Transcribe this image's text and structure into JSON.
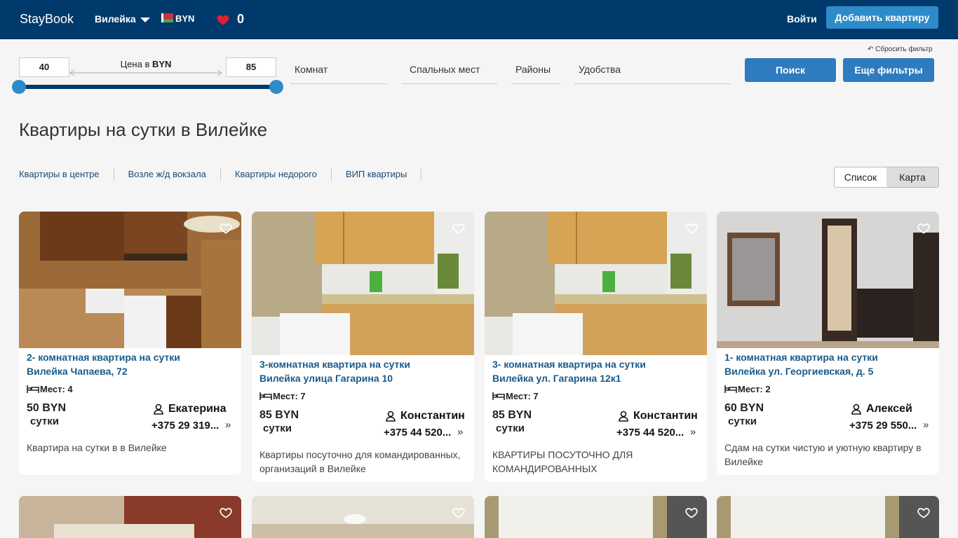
{
  "header": {
    "logo": "StayBook",
    "city": "Вилейка",
    "currency": "BYN",
    "favorites_count": "0",
    "login": "Войти",
    "add_listing": "Добавить квартиру"
  },
  "filters": {
    "price_min": "40",
    "price_max": "85",
    "price_label_prefix": "Цена в ",
    "price_label_currency": "BYN",
    "rooms": "Комнат",
    "beds": "Спальных мест",
    "districts": "Районы",
    "amenities": "Удобства",
    "reset": "↶ Сбросить фильтр",
    "search": "Поиск",
    "more_filters": "Еще фильтры"
  },
  "page": {
    "title": "Квартиры на сутки в Вилейке",
    "quick_links": [
      "Квартиры в центре",
      "Возле ж/д вокзала",
      "Квартиры недорого",
      "ВИП квартиры"
    ],
    "view_list": "Список",
    "view_map": "Карта"
  },
  "listings": [
    {
      "title_line1": "2- комнатная квартира на сутки",
      "title_line2": "Вилейка Чапаева, 72",
      "places": "Мест: 4",
      "price": "50 BYN",
      "per": "сутки",
      "owner": "Екатерина",
      "phone": "+375 29 319...",
      "desc": "Квартира на сутки в в Вилейке"
    },
    {
      "title_line1": "3-комнатная квартира на сутки",
      "title_line2": "Вилейка улица Гагарина 10",
      "places": "Мест: 7",
      "price": "85 BYN",
      "per": "сутки",
      "owner": "Константин",
      "phone": "+375 44 520...",
      "desc": "Квартиры посуточно для командированных, организаций в Вилейке"
    },
    {
      "title_line1": "3- комнатная квартира на сутки",
      "title_line2": "Вилейка ул. Гагарина 12к1",
      "places": "Мест: 7",
      "price": "85 BYN",
      "per": "сутки",
      "owner": "Константин",
      "phone": "+375 44 520...",
      "desc": "КВАРТИРЫ ПОСУТОЧНО ДЛЯ КОМАНДИРОВАННЫХ"
    },
    {
      "title_line1": "1- комнатная квартира на сутки",
      "title_line2": "Вилейка ул. Георгиевская, д. 5",
      "places": "Мест: 2",
      "price": "60 BYN",
      "per": "сутки",
      "owner": "Алексей",
      "phone": "+375 29 550...",
      "desc": "Сдам на сутки чистую и уютную квартиру в Вилейке"
    }
  ],
  "colors": {
    "header_bg": "#003a6c",
    "accent": "#2e8bc9",
    "heart": "#e0202c",
    "link": "#1a5a8a"
  }
}
